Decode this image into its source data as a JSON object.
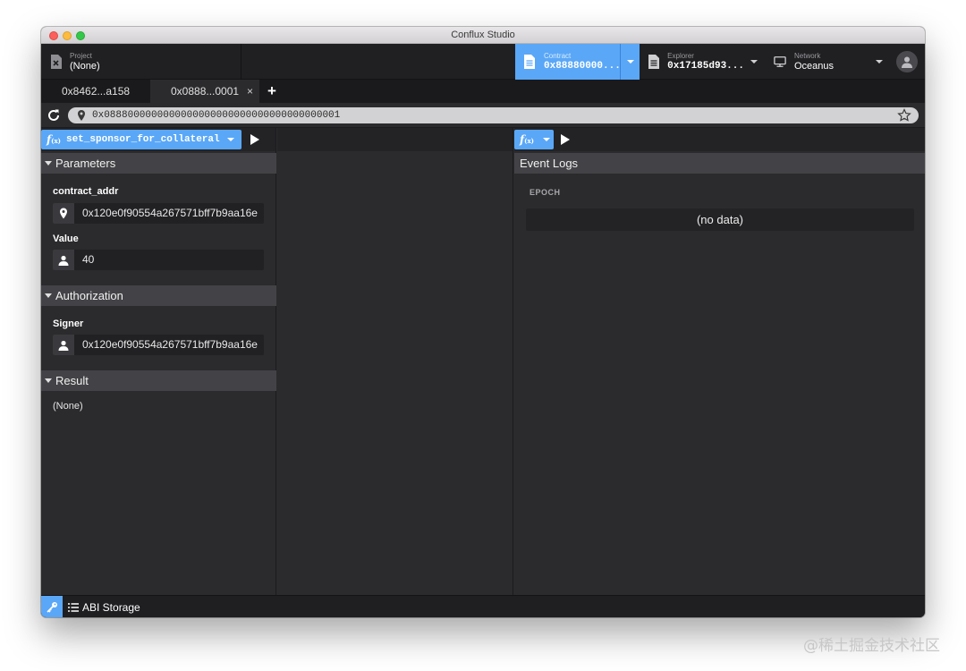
{
  "window": {
    "title": "Conflux Studio"
  },
  "header": {
    "project": {
      "label": "Project",
      "value": "(None)"
    },
    "contract": {
      "label": "Contract",
      "value": "0x88880000..."
    },
    "explorer": {
      "label": "Explorer",
      "value": "0x17185d93..."
    },
    "network": {
      "label": "Network",
      "value": "Oceanus"
    }
  },
  "tabs": [
    {
      "label": "0x8462...a158"
    },
    {
      "label": "0x0888...0001",
      "close": "×"
    }
  ],
  "tab_add": "+",
  "address": {
    "url": "0x0888000000000000000000000000000000000001"
  },
  "left": {
    "function_name": "set_sponsor_for_collateral",
    "fn_glyph": "f",
    "fn_glyph_sub": "(x)",
    "sections": {
      "parameters": "Parameters",
      "authorization": "Authorization",
      "result": "Result"
    },
    "params": [
      {
        "label": "contract_addr",
        "value": "0x120e0f90554a267571bff7b9aa16e",
        "icon": "map-pin-icon"
      },
      {
        "label": "Value",
        "value": "40",
        "icon": "user-icon"
      }
    ],
    "signer": {
      "label": "Signer",
      "value": "0x120e0f90554a267571bff7b9aa16e",
      "icon": "user-icon"
    },
    "result_value": "(None)"
  },
  "right": {
    "fn_glyph": "f",
    "fn_glyph_sub": "(x)",
    "title": "Event Logs",
    "column": "EPOCH",
    "empty": "(no data)"
  },
  "bottom": {
    "abi_label": "ABI Storage"
  },
  "watermark": "@稀土掘金技术社区",
  "colors": {
    "accent": "#5aa7f7",
    "background": "#2b2b2e",
    "section": "#434347"
  }
}
